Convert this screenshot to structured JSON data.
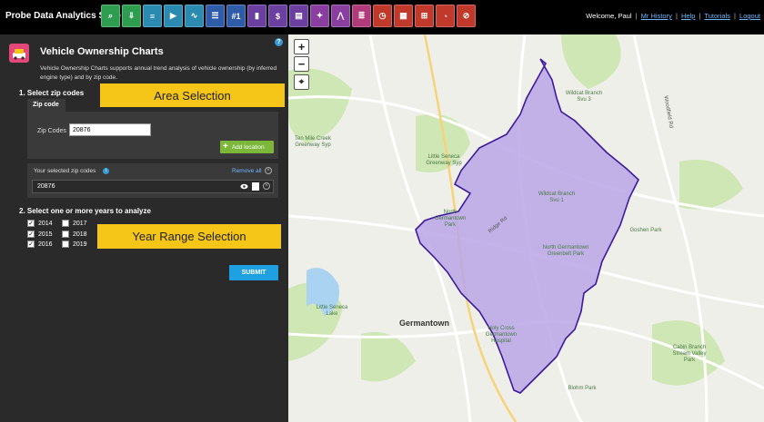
{
  "header": {
    "app_title": "Probe Data Analytics Suite",
    "welcome": "Welcome, Paul",
    "links": [
      "Mr History",
      "Help",
      "Tutorials",
      "Logout"
    ],
    "separator": "|",
    "tools": [
      {
        "icon": "search-tool-icon",
        "color": "#2e9d4f",
        "glyph": "⌕"
      },
      {
        "icon": "download-tool-icon",
        "color": "#2e9d4f",
        "glyph": "⇓"
      },
      {
        "icon": "road-tool-icon",
        "color": "#2a8ab0",
        "glyph": "≡"
      },
      {
        "icon": "play-tool-icon",
        "color": "#2a8ab0",
        "glyph": "▶"
      },
      {
        "icon": "trend-tool-icon",
        "color": "#2a8ab0",
        "glyph": "∿"
      },
      {
        "icon": "list-tool-icon",
        "color": "#2f5ca8",
        "glyph": "☰"
      },
      {
        "icon": "rank-tool-icon",
        "color": "#2f5ca8",
        "glyph": "#1"
      },
      {
        "icon": "bars-tool-icon",
        "color": "#6b3fa0",
        "glyph": "▮"
      },
      {
        "icon": "dollar-tool-icon",
        "color": "#6b3fa0",
        "glyph": "$"
      },
      {
        "icon": "report-tool-icon",
        "color": "#6b3fa0",
        "glyph": "▤"
      },
      {
        "icon": "map-tool-icon",
        "color": "#8a3fa0",
        "glyph": "✦"
      },
      {
        "icon": "network-tool-icon",
        "color": "#8a3fa0",
        "glyph": "⋀"
      },
      {
        "icon": "doc-tool-icon",
        "color": "#b03a7a",
        "glyph": "≣"
      },
      {
        "icon": "clock-tool-icon",
        "color": "#c0392b",
        "glyph": "◷"
      },
      {
        "icon": "vehicle-tool-icon",
        "color": "#c0392b",
        "glyph": "▦"
      },
      {
        "icon": "grid-tool-icon",
        "color": "#c0392b",
        "glyph": "⊞"
      },
      {
        "icon": "gauge-tool-icon",
        "color": "#c0392b",
        "glyph": "◔"
      },
      {
        "icon": "speed-tool-icon",
        "color": "#c0392b",
        "glyph": "⊘"
      }
    ]
  },
  "panel": {
    "title": "Vehicle Ownership Charts",
    "description": "Vehicle Ownership Charts supports annual trend analysis of vehicle ownership (by inferred engine type) and by zip code.",
    "section1": "1. Select zip codes",
    "area_callout": "Area Selection",
    "zip_tab": "Zip code",
    "zip_label": "Zip Codes",
    "zip_value": "20876",
    "add_location": "Add location",
    "selected_label": "Your selected zip codes",
    "remove_all": "Remove all",
    "selected_zip": "20876",
    "section2": "2. Select one or more years to analyze",
    "year_callout": "Year Range Selection",
    "years": [
      {
        "label": "2014",
        "checked": true
      },
      {
        "label": "2017",
        "checked": false
      },
      {
        "label": "2015",
        "checked": true
      },
      {
        "label": "2018",
        "checked": false
      },
      {
        "label": "2016",
        "checked": true
      },
      {
        "label": "2019",
        "checked": false
      }
    ],
    "submit": "SUBMIT"
  },
  "map": {
    "zoom_in": "+",
    "zoom_out": "−",
    "labels": {
      "wildcat3": "Wildcat Branch Svu 3",
      "woodfield": "Woodfield Rd",
      "tenmile": "Ten Mile Creek Greenway Syp",
      "littleseneca_gw": "Little Seneca Greenway Syp",
      "wildcat1": "Wildcat Branch Svu 1",
      "northgermantown_park": "North Germantown Park",
      "goshen": "Goshen Park",
      "ridge": "Ridge Rd",
      "ngg": "North Germantown Greenbelt Park",
      "littleseneca_lake": "Little Seneca Lake",
      "germantown": "Germantown",
      "holycross": "Holy Cross Germantown Hospital",
      "cabin": "Cabin Branch Stream Valley Park",
      "blohm": "Blohm Park"
    },
    "colors": {
      "zip_fill": "#b9a6e6",
      "zip_stroke": "#3c1a9e",
      "park": "#cfe6b5",
      "road": "#ffffff"
    }
  }
}
